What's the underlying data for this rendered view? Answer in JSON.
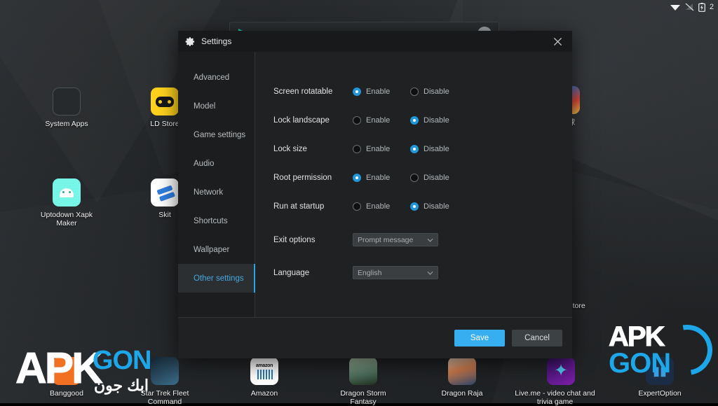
{
  "statusbar": {
    "icons": [
      "wifi-icon",
      "signal-off-icon",
      "battery-icon"
    ],
    "trailing_text": "2"
  },
  "playstore_searchbar": {
    "icon": "play-triangle-icon",
    "placeholder": "",
    "avatar": "account-avatar"
  },
  "desktop": {
    "apps": [
      {
        "label": "System Apps",
        "icon": "system-apps-icon"
      },
      {
        "label": "LD Store",
        "icon": "ld-store-icon"
      },
      {
        "label": "Uptodown Xapk Maker",
        "icon": "uptodown-xapk-maker-icon"
      },
      {
        "label": "Skit",
        "icon": "skit-icon"
      },
      {
        "label": "球",
        "icon": "ball-game-icon"
      },
      {
        "label": "pp Store",
        "icon": "app-store-icon"
      },
      {
        "label": "Banggood",
        "icon": "banggood-icon"
      },
      {
        "label": "Star Trek  Fleet Command",
        "icon": "star-trek-fleet-command-icon"
      },
      {
        "label": "Amazon",
        "icon": "amazon-icon"
      },
      {
        "label": "Dragon Storm Fantasy",
        "icon": "dragon-storm-fantasy-icon"
      },
      {
        "label": "Dragon Raja",
        "icon": "dragon-raja-icon"
      },
      {
        "label": "Live.me - video chat and trivia game",
        "icon": "liveme-icon"
      },
      {
        "label": "ExpertOption",
        "icon": "expertoption-icon"
      }
    ]
  },
  "dialog": {
    "title": "Settings",
    "title_icon": "gear-icon",
    "close_icon": "close-icon",
    "sidebar": {
      "items": [
        {
          "label": "Advanced",
          "active": false
        },
        {
          "label": "Model",
          "active": false
        },
        {
          "label": "Game settings",
          "active": false
        },
        {
          "label": "Audio",
          "active": false
        },
        {
          "label": "Network",
          "active": false
        },
        {
          "label": "Shortcuts",
          "active": false
        },
        {
          "label": "Wallpaper",
          "active": false
        },
        {
          "label": "Other settings",
          "active": true
        }
      ]
    },
    "settings": {
      "radio_rows": [
        {
          "label": "Screen rotatable",
          "enable_label": "Enable",
          "disable_label": "Disable",
          "selected": "enable"
        },
        {
          "label": "Lock landscape",
          "enable_label": "Enable",
          "disable_label": "Disable",
          "selected": "disable"
        },
        {
          "label": "Lock size",
          "enable_label": "Enable",
          "disable_label": "Disable",
          "selected": "disable"
        },
        {
          "label": "Root permission",
          "enable_label": "Enable",
          "disable_label": "Disable",
          "selected": "enable"
        },
        {
          "label": "Run at startup",
          "enable_label": "Enable",
          "disable_label": "Disable",
          "selected": "disable"
        }
      ],
      "select_rows": [
        {
          "label": "Exit options",
          "value": "Prompt message",
          "chevron": "chevron-down-icon"
        },
        {
          "label": "Language",
          "value": "English",
          "chevron": "chevron-down-icon"
        }
      ]
    },
    "footer": {
      "save_label": "Save",
      "cancel_label": "Cancel"
    }
  },
  "watermark": {
    "apk": "APK",
    "gon": "GON",
    "arabic": "ابك جون"
  },
  "colors": {
    "accent_blue": "#2fa0e0",
    "radio_on": "#2196d9",
    "save_button": "#37aef0",
    "cancel_button": "#3c4144",
    "dialog_bg": "#1f2123",
    "titlebar_bg": "#17191a",
    "sidebar_bg": "#1b1d1f",
    "watermark_blue": "#1ea7e8"
  }
}
